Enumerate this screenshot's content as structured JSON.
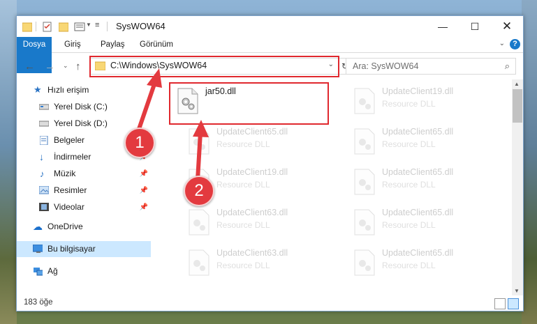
{
  "window": {
    "title": "SysWOW64",
    "ribbon_tabs": [
      "Dosya",
      "Giriş",
      "Paylaş",
      "Görünüm"
    ],
    "help": "?"
  },
  "address_bar": {
    "path": "C:\\Windows\\SysWOW64"
  },
  "search": {
    "placeholder": "Ara: SysWOW64"
  },
  "nav_pane": {
    "items": [
      {
        "label": "Hızlı erişim"
      },
      {
        "label": "Yerel Disk (C:)"
      },
      {
        "label": "Yerel Disk (D:)"
      },
      {
        "label": "Belgeler"
      },
      {
        "label": "İndirmeler"
      },
      {
        "label": "Müzik"
      },
      {
        "label": "Resimler"
      },
      {
        "label": "Videolar"
      },
      {
        "label": "OneDrive"
      },
      {
        "label": "Bu bilgisayar"
      },
      {
        "label": "Ağ"
      }
    ]
  },
  "files": [
    {
      "name": "jar50.dll",
      "type": ""
    },
    {
      "name": "UpdateClient19.dll",
      "type": "Resource DLL"
    },
    {
      "name": "UpdateClient65.dll",
      "type": "Resource DLL"
    },
    {
      "name": "UpdateClient65.dll",
      "type": "Resource DLL"
    },
    {
      "name": "UpdateClient19.dll",
      "type": "Resource DLL"
    },
    {
      "name": "UpdateClient65.dll",
      "type": "Resource DLL"
    },
    {
      "name": "UpdateClient63.dll",
      "type": "Resource DLL"
    },
    {
      "name": "UpdateClient65.dll",
      "type": "Resource DLL"
    },
    {
      "name": "UpdateClient63.dll",
      "type": "Resource DLL"
    },
    {
      "name": "UpdateClient65.dll",
      "type": "Resource DLL"
    }
  ],
  "status": {
    "item_count": "183 öğe"
  },
  "annotations": {
    "step1": "1",
    "step2": "2"
  },
  "colors": {
    "accent": "#1979ca",
    "highlight": "#e0282e",
    "selection": "#cce8ff"
  }
}
